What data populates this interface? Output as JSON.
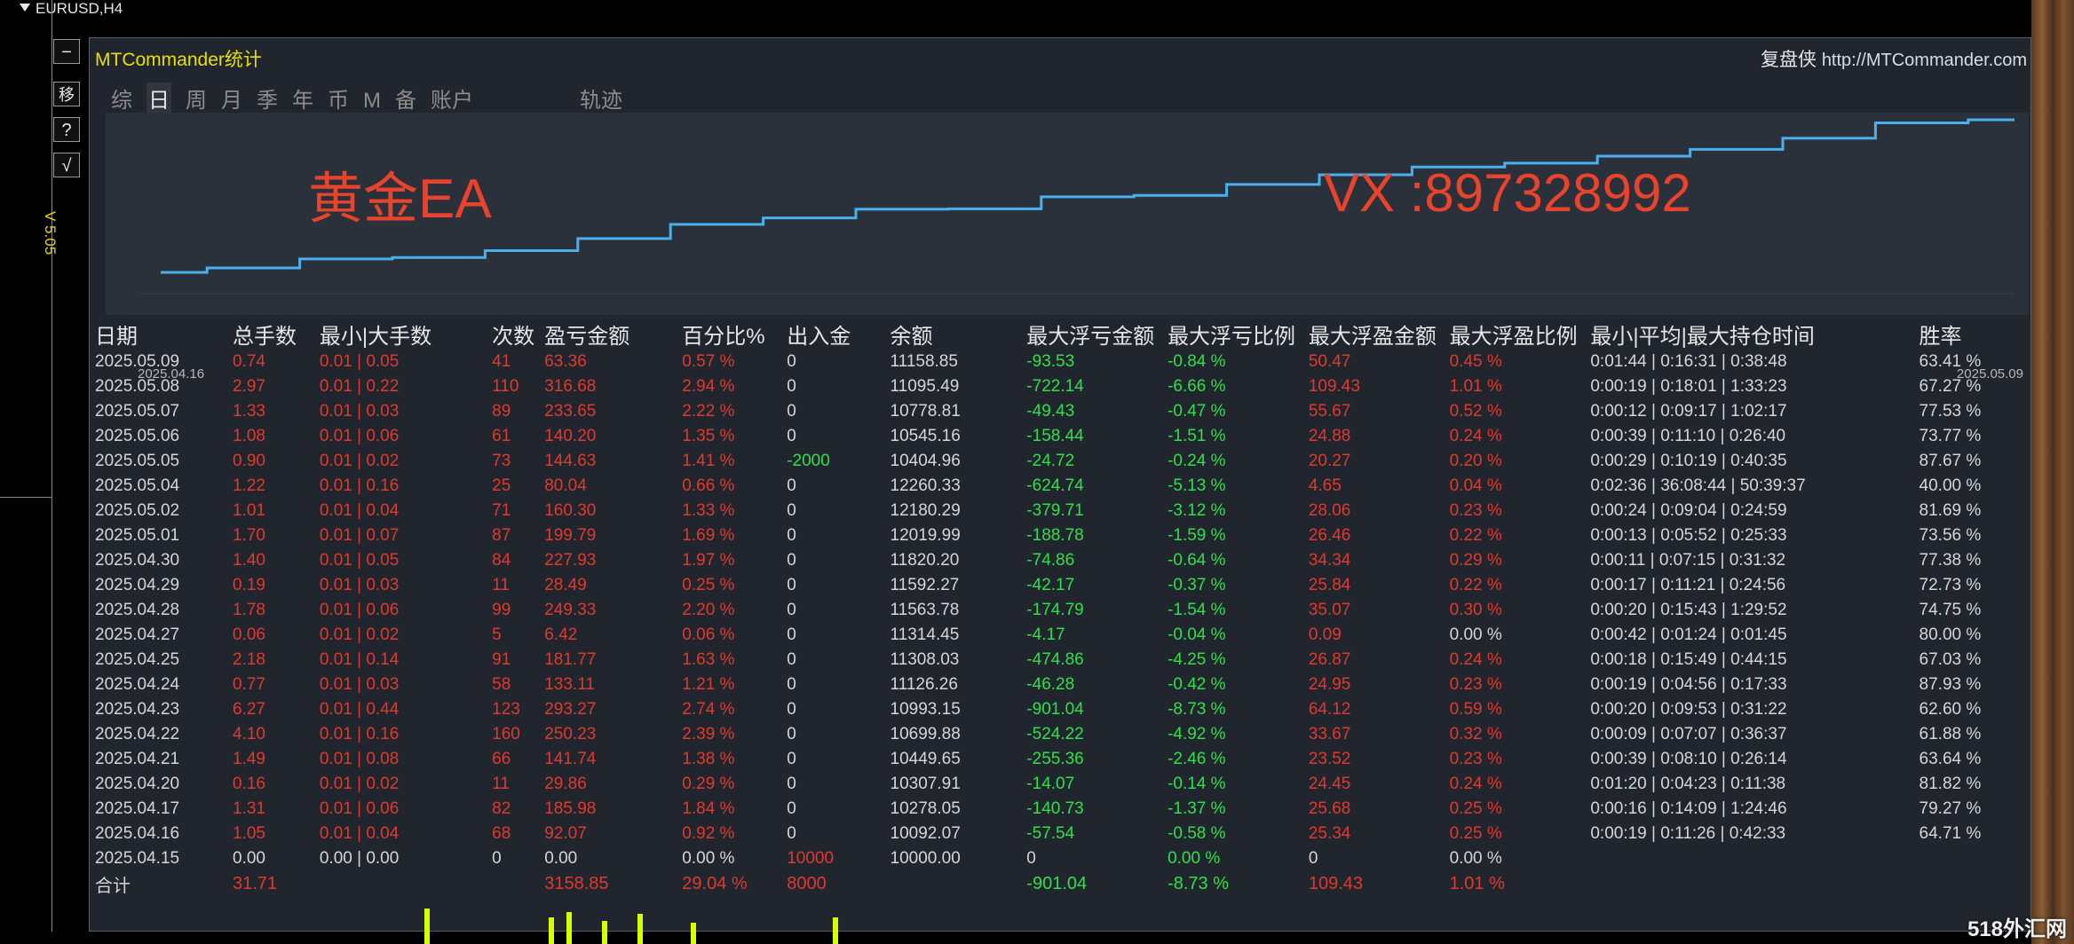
{
  "window": {
    "title": "EURUSD,H4"
  },
  "side_buttons": [
    "−",
    "移",
    "?",
    "√"
  ],
  "version": "V 5.05",
  "panel": {
    "title": "MTCommander统计",
    "brand": "复盘侠",
    "url": "http://MTCommander.com",
    "tabs": [
      "综",
      "日",
      "周",
      "月",
      "季",
      "年",
      "币",
      "M",
      "备",
      "账户",
      "轨迹"
    ],
    "active_tab": "日"
  },
  "equity_curve": {
    "start_date": "2025.04.16",
    "end_date": "2025.05.09",
    "line_color": "#4ab0ee",
    "balances": [
      10092.07,
      10278.05,
      10307.91,
      10449.65,
      10699.88,
      10993.15,
      11126.26,
      11308.03,
      11314.45,
      11563.78,
      11592.27,
      11820.2,
      12019.99,
      12180.29,
      12260.33,
      12404.96,
      12545.16,
      12778.81,
      13095.49,
      13158.85
    ]
  },
  "overlay": {
    "gold_text": "黄金EA",
    "vx_text": "VX :897328992"
  },
  "table": {
    "headers": [
      "日期",
      "总手数",
      "最小|大手数",
      "次数",
      "盈亏金额",
      "百分比%",
      "出入金",
      "余额",
      "最大浮亏金额",
      "最大浮亏比例",
      "最大浮盈金额",
      "最大浮盈比例",
      "最小|平均|最大持仓时间",
      "胜率"
    ],
    "rows": [
      [
        "2025.05.09",
        "0.74",
        "0.01 | 0.05",
        "41",
        "63.36",
        "0.57 %",
        "0",
        "11158.85",
        "-93.53",
        "-0.84 %",
        "50.47",
        "0.45 %",
        "0:01:44 | 0:16:31 | 0:38:48",
        "63.41 %"
      ],
      [
        "2025.05.08",
        "2.97",
        "0.01 | 0.22",
        "110",
        "316.68",
        "2.94 %",
        "0",
        "11095.49",
        "-722.14",
        "-6.66 %",
        "109.43",
        "1.01 %",
        "0:00:19 | 0:18:01 | 1:33:23",
        "67.27 %"
      ],
      [
        "2025.05.07",
        "1.33",
        "0.01 | 0.03",
        "89",
        "233.65",
        "2.22 %",
        "0",
        "10778.81",
        "-49.43",
        "-0.47 %",
        "55.67",
        "0.52 %",
        "0:00:12 | 0:09:17 | 1:02:17",
        "77.53 %"
      ],
      [
        "2025.05.06",
        "1.08",
        "0.01 | 0.06",
        "61",
        "140.20",
        "1.35 %",
        "0",
        "10545.16",
        "-158.44",
        "-1.51 %",
        "24.88",
        "0.24 %",
        "0:00:39 | 0:11:10 | 0:26:40",
        "73.77 %"
      ],
      [
        "2025.05.05",
        "0.90",
        "0.01 | 0.02",
        "73",
        "144.63",
        "1.41 %",
        "-2000",
        "10404.96",
        "-24.72",
        "-0.24 %",
        "20.27",
        "0.20 %",
        "0:00:29 | 0:10:19 | 0:40:35",
        "87.67 %"
      ],
      [
        "2025.05.04",
        "1.22",
        "0.01 | 0.16",
        "25",
        "80.04",
        "0.66 %",
        "0",
        "12260.33",
        "-624.74",
        "-5.13 %",
        "4.65",
        "0.04 %",
        "0:02:36 | 36:08:44 | 50:39:37",
        "40.00 %"
      ],
      [
        "2025.05.02",
        "1.01",
        "0.01 | 0.04",
        "71",
        "160.30",
        "1.33 %",
        "0",
        "12180.29",
        "-379.71",
        "-3.12 %",
        "28.06",
        "0.23 %",
        "0:00:24 | 0:09:04 | 0:24:59",
        "81.69 %"
      ],
      [
        "2025.05.01",
        "1.70",
        "0.01 | 0.07",
        "87",
        "199.79",
        "1.69 %",
        "0",
        "12019.99",
        "-188.78",
        "-1.59 %",
        "26.46",
        "0.22 %",
        "0:00:13 | 0:05:52 | 0:25:33",
        "73.56 %"
      ],
      [
        "2025.04.30",
        "1.40",
        "0.01 | 0.05",
        "84",
        "227.93",
        "1.97 %",
        "0",
        "11820.20",
        "-74.86",
        "-0.64 %",
        "34.34",
        "0.29 %",
        "0:00:11 | 0:07:15 | 0:31:32",
        "77.38 %"
      ],
      [
        "2025.04.29",
        "0.19",
        "0.01 | 0.03",
        "11",
        "28.49",
        "0.25 %",
        "0",
        "11592.27",
        "-42.17",
        "-0.37 %",
        "25.84",
        "0.22 %",
        "0:00:17 | 0:11:21 | 0:24:56",
        "72.73 %"
      ],
      [
        "2025.04.28",
        "1.78",
        "0.01 | 0.06",
        "99",
        "249.33",
        "2.20 %",
        "0",
        "11563.78",
        "-174.79",
        "-1.54 %",
        "35.07",
        "0.30 %",
        "0:00:20 | 0:15:43 | 1:29:52",
        "74.75 %"
      ],
      [
        "2025.04.27",
        "0.06",
        "0.01 | 0.02",
        "5",
        "6.42",
        "0.06 %",
        "0",
        "11314.45",
        "-4.17",
        "-0.04 %",
        "0.09",
        "0.00 %",
        "0:00:42 | 0:01:24 | 0:01:45",
        "80.00 %"
      ],
      [
        "2025.04.25",
        "2.18",
        "0.01 | 0.14",
        "91",
        "181.77",
        "1.63 %",
        "0",
        "11308.03",
        "-474.86",
        "-4.25 %",
        "26.87",
        "0.24 %",
        "0:00:18 | 0:15:49 | 0:44:15",
        "67.03 %"
      ],
      [
        "2025.04.24",
        "0.77",
        "0.01 | 0.03",
        "58",
        "133.11",
        "1.21 %",
        "0",
        "11126.26",
        "-46.28",
        "-0.42 %",
        "24.95",
        "0.23 %",
        "0:00:19 | 0:04:56 | 0:17:33",
        "87.93 %"
      ],
      [
        "2025.04.23",
        "6.27",
        "0.01 | 0.44",
        "123",
        "293.27",
        "2.74 %",
        "0",
        "10993.15",
        "-901.04",
        "-8.73 %",
        "64.12",
        "0.59 %",
        "0:00:20 | 0:09:53 | 0:31:22",
        "62.60 %"
      ],
      [
        "2025.04.22",
        "4.10",
        "0.01 | 0.16",
        "160",
        "250.23",
        "2.39 %",
        "0",
        "10699.88",
        "-524.22",
        "-4.92 %",
        "33.67",
        "0.32 %",
        "0:00:09 | 0:07:07 | 0:36:37",
        "61.88 %"
      ],
      [
        "2025.04.21",
        "1.49",
        "0.01 | 0.08",
        "66",
        "141.74",
        "1.38 %",
        "0",
        "10449.65",
        "-255.36",
        "-2.46 %",
        "23.52",
        "0.23 %",
        "0:00:39 | 0:08:10 | 0:26:14",
        "63.64 %"
      ],
      [
        "2025.04.20",
        "0.16",
        "0.01 | 0.02",
        "11",
        "29.86",
        "0.29 %",
        "0",
        "10307.91",
        "-14.07",
        "-0.14 %",
        "24.45",
        "0.24 %",
        "0:01:20 | 0:04:23 | 0:11:38",
        "81.82 %"
      ],
      [
        "2025.04.17",
        "1.31",
        "0.01 | 0.06",
        "82",
        "185.98",
        "1.84 %",
        "0",
        "10278.05",
        "-140.73",
        "-1.37 %",
        "25.68",
        "0.25 %",
        "0:00:16 | 0:14:09 | 1:24:46",
        "79.27 %"
      ],
      [
        "2025.04.16",
        "1.05",
        "0.01 | 0.04",
        "68",
        "92.07",
        "0.92 %",
        "0",
        "10092.07",
        "-57.54",
        "-0.58 %",
        "25.34",
        "0.25 %",
        "0:00:19 | 0:11:26 | 0:42:33",
        "64.71 %"
      ],
      [
        "2025.04.15",
        "0.00",
        "0.00 | 0.00",
        "0",
        "0.00",
        "0.00 %",
        "10000",
        "10000.00",
        "0",
        "0.00 %",
        "0",
        "0.00 %",
        "",
        ""
      ]
    ],
    "total": [
      "合计",
      "31.71",
      "",
      "",
      "3158.85",
      "29.04 %",
      "8000",
      "",
      "-901.04",
      "-8.73 %",
      "109.43",
      "1.01 %",
      "",
      ""
    ]
  },
  "watermark": "518外汇网",
  "colors": {
    "positive": "#e03a2e",
    "negative": "#2ee04a",
    "neutral": "#d6d6d6",
    "title": "#e7e000"
  }
}
